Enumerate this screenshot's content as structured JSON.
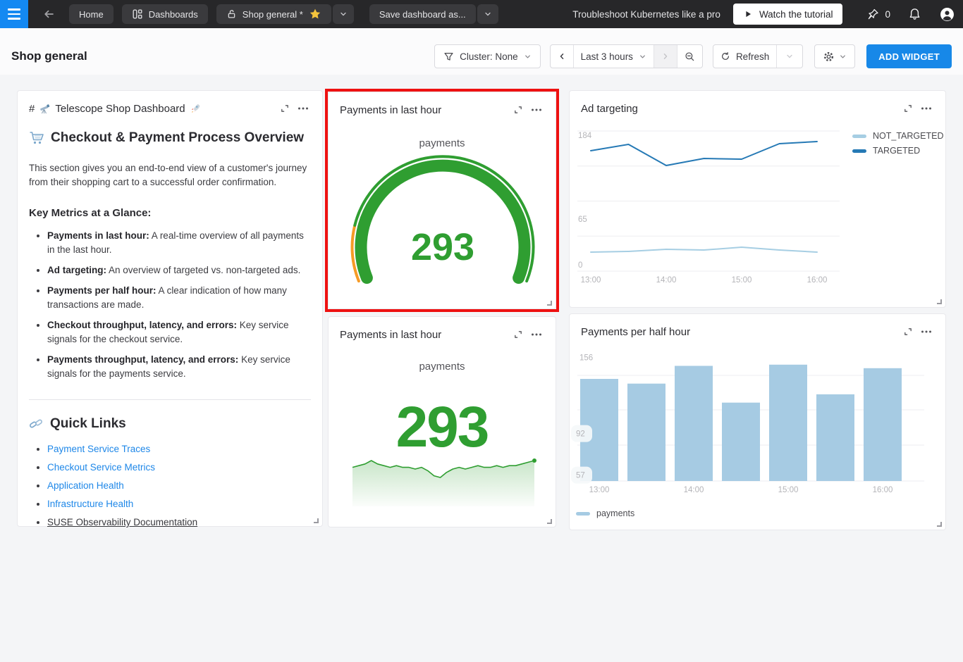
{
  "navbar": {
    "home_label": "Home",
    "dashboards_label": "Dashboards",
    "dashboard_tab_label": "Shop general *",
    "save_dashboard_label": "Save dashboard as...",
    "promo_text": "Troubleshoot Kubernetes like a pro",
    "watch_tutorial_label": "Watch the tutorial",
    "pin_count": "0"
  },
  "header": {
    "page_title": "Shop general",
    "cluster_filter_label": "Cluster: None",
    "time_range_label": "Last 3 hours",
    "refresh_label": "Refresh",
    "add_widget_label": "ADD WIDGET"
  },
  "md": {
    "widget_title_prefix": "#",
    "widget_title": "Telescope Shop Dashboard",
    "widget_title_emojis": [
      "🔭",
      "🚀"
    ],
    "h2": "Checkout & Payment Process Overview",
    "h2_emoji": "🛒",
    "intro": "This section gives you an end-to-end view of a customer's journey from their shopping cart to a successful order confirmation.",
    "h3": "Key Metrics at a Glance:",
    "bullets": [
      {
        "bold": "Payments in last hour:",
        "text": " A real-time overview of all payments in the last hour."
      },
      {
        "bold": "Ad targeting:",
        "text": " An overview of targeted vs. non-targeted ads."
      },
      {
        "bold": "Payments per half hour:",
        "text": " A clear indication of how many transactions are made."
      },
      {
        "bold": "Checkout throughput, latency, and errors:",
        "text": " Key service signals for the checkout service."
      },
      {
        "bold": "Payments throughput, latency, and errors:",
        "text": " Key service signals for the payments service."
      }
    ],
    "quick_links_title": "Quick Links",
    "quick_links_emoji": "🔗",
    "links": [
      "Payment Service Traces",
      "Checkout Service Metrics",
      "Application Health",
      "Infrastructure Health",
      "SUSE Observability Documentation"
    ]
  },
  "colors": {
    "accent_blue": "#1788e8",
    "green": "#2f9e31",
    "orange": "#f69b26",
    "light_blue": "#a6cee3",
    "dark_blue": "#2579b5",
    "highlight_red": "#ee1111",
    "star_gold": "#f3c33c"
  },
  "chart_data": [
    {
      "id": "gauge",
      "type": "gauge",
      "title": "Payments in last hour",
      "series_label": "payments",
      "value": 293,
      "gauge": {
        "start_angle": 248,
        "sweep": 224,
        "warn_sweep": 36,
        "ok_color": "#2f9e31",
        "warn_color": "#f69b26"
      }
    },
    {
      "id": "bignum",
      "type": "line",
      "title": "Payments in last hour",
      "series_label": "payments",
      "value": 293,
      "color": "#2f9e31",
      "sparkline": [
        292,
        293,
        294,
        296,
        294,
        293,
        292,
        293,
        292,
        292,
        291,
        292,
        290,
        287,
        286,
        289,
        291,
        292,
        291,
        292,
        293,
        292,
        292,
        293,
        292,
        293,
        293,
        294,
        295,
        296
      ]
    },
    {
      "id": "ad",
      "type": "line",
      "title": "Ad targeting",
      "x": [
        "13:00",
        "13:30",
        "14:00",
        "14:30",
        "15:00",
        "15:30",
        "16:00"
      ],
      "series": [
        {
          "name": "NOT_TARGETED",
          "color": "#a6cee3",
          "values": [
            18,
            19,
            22,
            21,
            25,
            21,
            18
          ]
        },
        {
          "name": "TARGETED",
          "color": "#2579b5",
          "values": [
            162,
            171,
            141,
            151,
            150,
            172,
            175
          ]
        }
      ],
      "yticks": [
        184,
        65,
        0
      ],
      "xticks": [
        "13:00",
        "14:00",
        "15:00",
        "16:00"
      ],
      "ylim": [
        0,
        190
      ],
      "xlabel": "",
      "ylabel": "",
      "legend_position": "right"
    },
    {
      "id": "bars",
      "type": "bar",
      "title": "Payments per half hour",
      "categories": [
        "13:00",
        "13:30",
        "14:00",
        "14:30",
        "15:00",
        "15:30",
        "16:00"
      ],
      "values": [
        138,
        134,
        149,
        118,
        150,
        125,
        147
      ],
      "yticks": [
        156,
        92,
        57
      ],
      "xticks": [
        "13:00",
        "14:00",
        "15:00",
        "16:00"
      ],
      "ylim": [
        52,
        160
      ],
      "xlabel": "",
      "ylabel": "",
      "legend": "payments",
      "color": "#a6cbe3",
      "legend_position": "bottom"
    }
  ]
}
